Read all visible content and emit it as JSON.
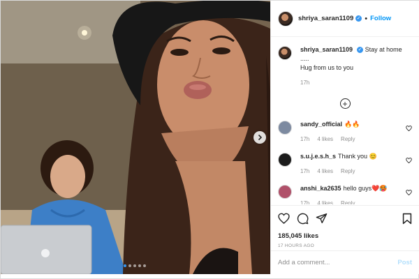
{
  "post": {
    "username": "shriya_saran1109",
    "separator": "•",
    "follow_label": "Follow",
    "verified_mark": "✓"
  },
  "caption": {
    "username": "shriya_saran1109",
    "text": "Stay at home .....",
    "text2": "Hug from us to you",
    "time": "17h"
  },
  "comments": [
    {
      "username": "sandy_official",
      "text": "🔥🔥",
      "time": "17h",
      "likes": "4 likes",
      "reply": "Reply",
      "avatar_color": "#7d8aa0"
    },
    {
      "username": "s.u.j.e.s.h_s",
      "text": "Thank you 😊",
      "time": "17h",
      "likes": "4 likes",
      "reply": "Reply",
      "avatar_color": "#1c1c1c"
    },
    {
      "username": "anshi_ka2635",
      "text": "hello guys❤️🥵",
      "time": "17h",
      "likes": "4 likes",
      "reply": "Reply",
      "avatar_color": "#b0516a"
    }
  ],
  "stats": {
    "likes": "185,045 likes",
    "timestamp": "17 HOURS AGO"
  },
  "add_comment": {
    "placeholder": "Add a comment...",
    "post_label": "Post"
  },
  "colors": {
    "accent": "#0095f6",
    "verified": "#3897f0",
    "muted": "#8e8e8e"
  },
  "carousel": {
    "slides": 5,
    "active_index": 0
  },
  "icons": [
    "heart-icon",
    "comment-icon",
    "share-icon",
    "bookmark-icon",
    "more-options-icon",
    "chevron-right-icon",
    "add-circle-icon"
  ]
}
